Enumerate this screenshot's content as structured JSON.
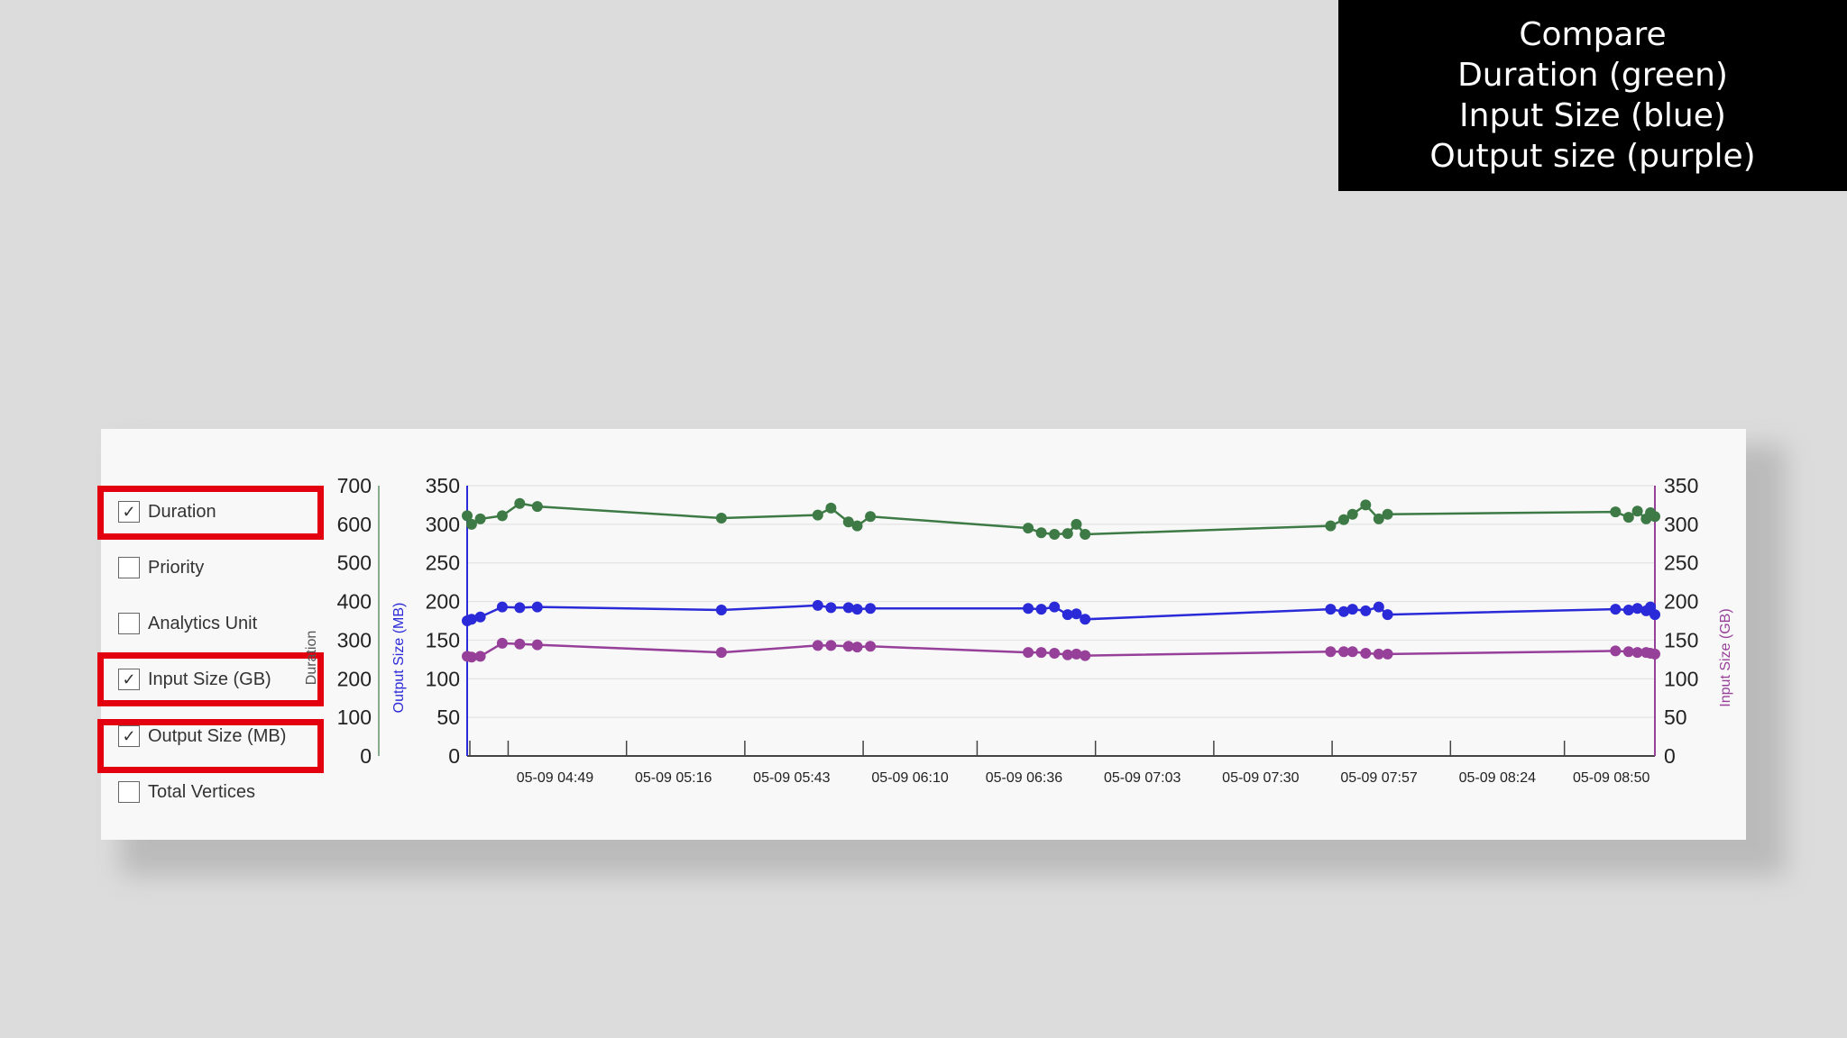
{
  "callout": {
    "lines": [
      "Compare",
      "Duration (green)",
      "Input Size (blue)",
      "Output size (purple)"
    ]
  },
  "checkboxes": [
    {
      "label": "Duration",
      "checked": true,
      "highlighted": true
    },
    {
      "label": "Priority",
      "checked": false,
      "highlighted": false
    },
    {
      "label": "Analytics Unit",
      "checked": false,
      "highlighted": false
    },
    {
      "label": "Input Size (GB)",
      "checked": true,
      "highlighted": true
    },
    {
      "label": "Output Size (MB)",
      "checked": true,
      "highlighted": true
    },
    {
      "label": "Total Vertices",
      "checked": false,
      "highlighted": false
    }
  ],
  "check_glyph": "✓",
  "colors": {
    "highlight": "#e3000f",
    "duration": "#3d7a46",
    "input": "#2a2ad8",
    "output": "#97409a",
    "grid": "#dedede",
    "axis": "#444444"
  },
  "chart_data": {
    "type": "line",
    "axes": {
      "duration": {
        "label": "Duration",
        "ticks": [
          "0",
          "100",
          "200",
          "300",
          "400",
          "500",
          "600",
          "700"
        ],
        "range": [
          0,
          700
        ],
        "color": "#3d7a46"
      },
      "output": {
        "label": "Output Size (MB)",
        "ticks": [
          "0",
          "50",
          "100",
          "150",
          "200",
          "250",
          "300",
          "350"
        ],
        "range": [
          0,
          350
        ],
        "color": "#2a2ad8"
      },
      "input": {
        "label": "Input Size (GB)",
        "ticks": [
          "0",
          "50",
          "100",
          "150",
          "200",
          "250",
          "300",
          "350"
        ],
        "range": [
          0,
          350
        ],
        "color": "#97409a"
      }
    },
    "x_ticks": [
      "05-09 04:49",
      "05-09 05:16",
      "05-09 05:43",
      "05-09 06:10",
      "05-09 06:36",
      "05-09 07:03",
      "05-09 07:30",
      "05-09 07:57",
      "05-09 08:24",
      "05-09 08:50"
    ],
    "x_range": [
      "05-09 04:38",
      "05-09 09:09"
    ],
    "grid": true,
    "series": [
      {
        "name": "Duration",
        "axis": "duration",
        "color": "#3d7a46",
        "points": [
          [
            "05-09 04:38",
            622
          ],
          [
            "05-09 04:39",
            600
          ],
          [
            "05-09 04:41",
            614
          ],
          [
            "05-09 04:46",
            622
          ],
          [
            "05-09 04:50",
            654
          ],
          [
            "05-09 04:54",
            646
          ],
          [
            "05-09 05:36",
            616
          ],
          [
            "05-09 05:58",
            624
          ],
          [
            "05-09 06:01",
            642
          ],
          [
            "05-09 06:05",
            606
          ],
          [
            "05-09 06:07",
            596
          ],
          [
            "05-09 06:10",
            620
          ],
          [
            "05-09 06:46",
            590
          ],
          [
            "05-09 06:49",
            578
          ],
          [
            "05-09 06:52",
            574
          ],
          [
            "05-09 06:55",
            576
          ],
          [
            "05-09 06:57",
            600
          ],
          [
            "05-09 06:59",
            574
          ],
          [
            "05-09 07:55",
            596
          ],
          [
            "05-09 07:58",
            612
          ],
          [
            "05-09 08:00",
            626
          ],
          [
            "05-09 08:03",
            650
          ],
          [
            "05-09 08:06",
            614
          ],
          [
            "05-09 08:08",
            626
          ],
          [
            "05-09 09:00",
            632
          ],
          [
            "05-09 09:03",
            618
          ],
          [
            "05-09 09:05",
            634
          ],
          [
            "05-09 09:07",
            614
          ],
          [
            "05-09 09:08",
            630
          ],
          [
            "05-09 09:09",
            620
          ]
        ]
      },
      {
        "name": "Input Size (GB)",
        "axis": "output",
        "color": "#2a2ad8",
        "points": [
          [
            "05-09 04:38",
            175
          ],
          [
            "05-09 04:39",
            177
          ],
          [
            "05-09 04:41",
            180
          ],
          [
            "05-09 04:46",
            193
          ],
          [
            "05-09 04:50",
            192
          ],
          [
            "05-09 04:54",
            193
          ],
          [
            "05-09 05:36",
            189
          ],
          [
            "05-09 05:58",
            195
          ],
          [
            "05-09 06:01",
            192
          ],
          [
            "05-09 06:05",
            192
          ],
          [
            "05-09 06:07",
            190
          ],
          [
            "05-09 06:10",
            191
          ],
          [
            "05-09 06:46",
            191
          ],
          [
            "05-09 06:49",
            190
          ],
          [
            "05-09 06:52",
            193
          ],
          [
            "05-09 06:55",
            183
          ],
          [
            "05-09 06:57",
            184
          ],
          [
            "05-09 06:59",
            177
          ],
          [
            "05-09 07:55",
            190
          ],
          [
            "05-09 07:58",
            187
          ],
          [
            "05-09 08:00",
            190
          ],
          [
            "05-09 08:03",
            188
          ],
          [
            "05-09 08:06",
            193
          ],
          [
            "05-09 08:08",
            183
          ],
          [
            "05-09 09:00",
            190
          ],
          [
            "05-09 09:03",
            189
          ],
          [
            "05-09 09:05",
            191
          ],
          [
            "05-09 09:07",
            188
          ],
          [
            "05-09 09:08",
            193
          ],
          [
            "05-09 09:09",
            183
          ]
        ]
      },
      {
        "name": "Output Size (MB)",
        "axis": "output",
        "color": "#97409a",
        "points": [
          [
            "05-09 04:38",
            129
          ],
          [
            "05-09 04:39",
            128
          ],
          [
            "05-09 04:41",
            129
          ],
          [
            "05-09 04:46",
            146
          ],
          [
            "05-09 04:50",
            145
          ],
          [
            "05-09 04:54",
            144
          ],
          [
            "05-09 05:36",
            134
          ],
          [
            "05-09 05:58",
            143
          ],
          [
            "05-09 06:01",
            143
          ],
          [
            "05-09 06:05",
            142
          ],
          [
            "05-09 06:07",
            141
          ],
          [
            "05-09 06:10",
            142
          ],
          [
            "05-09 06:46",
            134
          ],
          [
            "05-09 06:49",
            134
          ],
          [
            "05-09 06:52",
            133
          ],
          [
            "05-09 06:55",
            131
          ],
          [
            "05-09 06:57",
            132
          ],
          [
            "05-09 06:59",
            130
          ],
          [
            "05-09 07:55",
            135
          ],
          [
            "05-09 07:58",
            135
          ],
          [
            "05-09 08:00",
            135
          ],
          [
            "05-09 08:03",
            133
          ],
          [
            "05-09 08:06",
            132
          ],
          [
            "05-09 08:08",
            132
          ],
          [
            "05-09 09:00",
            136
          ],
          [
            "05-09 09:03",
            135
          ],
          [
            "05-09 09:05",
            134
          ],
          [
            "05-09 09:07",
            134
          ],
          [
            "05-09 09:08",
            133
          ],
          [
            "05-09 09:09",
            132
          ]
        ]
      }
    ]
  }
}
